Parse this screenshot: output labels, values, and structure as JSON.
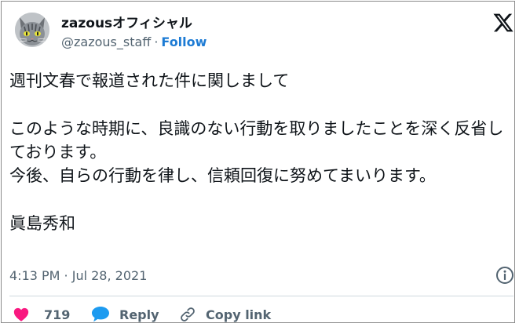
{
  "account": {
    "display_name": "zazousオフィシャル",
    "handle": "@zazous_staff",
    "separator": "·",
    "follow_label": "Follow"
  },
  "tweet": {
    "lines": [
      "週刊文春で報道された件に関しまして",
      "このような時期に、良識のない行動を取りましたことを深く反省しております。",
      "今後、自らの行動を律し、信頼回復に努めてまいります。",
      "眞島秀和"
    ],
    "timestamp": "4:13 PM · Jul 28, 2021"
  },
  "actions": {
    "like_count": "719",
    "reply_label": "Reply",
    "copy_link_label": "Copy link"
  },
  "icons": {
    "brand": "x-logo-icon",
    "info": "info-icon",
    "like": "heart-icon",
    "reply": "speech-bubble-icon",
    "copy": "link-icon"
  },
  "colors": {
    "follow": "#1d7bd4",
    "like": "#f91880",
    "reply": "#1d9bf0",
    "secondary_text": "#536471"
  }
}
